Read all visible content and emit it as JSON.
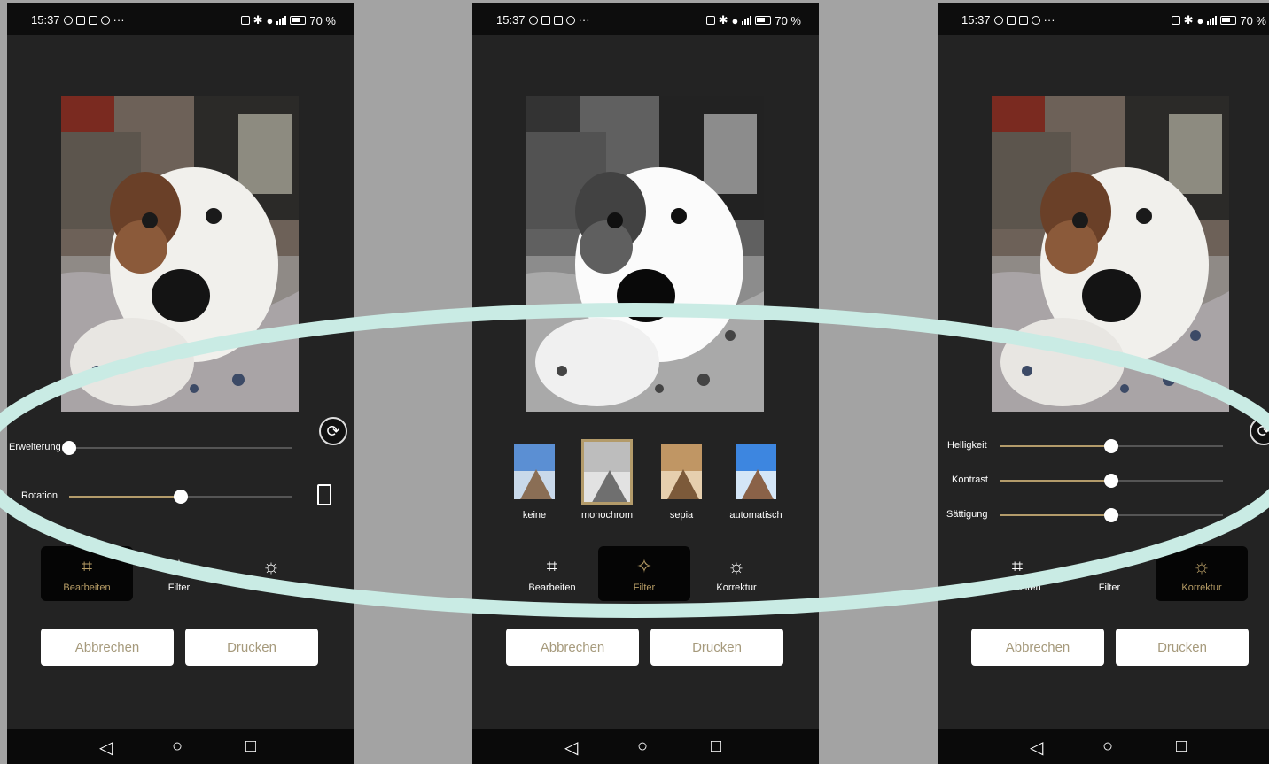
{
  "status": {
    "time": "15:37",
    "dots": "···",
    "battery": "70 %"
  },
  "colors": {
    "accent": "#b39b6a",
    "ring": "#c9ebe4",
    "background": "#232323"
  },
  "panels": [
    {
      "mode": "Bearbeiten",
      "sliders": [
        {
          "label": "Erweiterung",
          "value": 0.0
        },
        {
          "label": "Rotation",
          "value": 0.5
        }
      ],
      "tabs": [
        "Bearbeiten",
        "Filter",
        "Korrektur"
      ],
      "active_tab": 0,
      "buttons": {
        "cancel": "Abbrechen",
        "print": "Drucken"
      }
    },
    {
      "mode": "Filter",
      "filters": [
        "keine",
        "monochrom",
        "sepia",
        "automatisch"
      ],
      "selected_filter": "monochrom",
      "tabs": [
        "Bearbeiten",
        "Filter",
        "Korrektur"
      ],
      "active_tab": 1,
      "buttons": {
        "cancel": "Abbrechen",
        "print": "Drucken"
      }
    },
    {
      "mode": "Korrektur",
      "sliders": [
        {
          "label": "Helligkeit",
          "value": 0.5
        },
        {
          "label": "Kontrast",
          "value": 0.5
        },
        {
          "label": "Sättigung",
          "value": 0.5
        }
      ],
      "tabs": [
        "Bearbeiten",
        "Filter",
        "Korrektur"
      ],
      "active_tab": 2,
      "buttons": {
        "cancel": "Abbrechen",
        "print": "Drucken"
      }
    }
  ],
  "icons": {
    "rotate": "rotate-icon",
    "crop": "crop-icon",
    "filter": "magic-wand-icon",
    "correction": "brightness-icon",
    "back": "nav-back-icon",
    "home": "nav-home-icon",
    "recents": "nav-recents-icon"
  }
}
